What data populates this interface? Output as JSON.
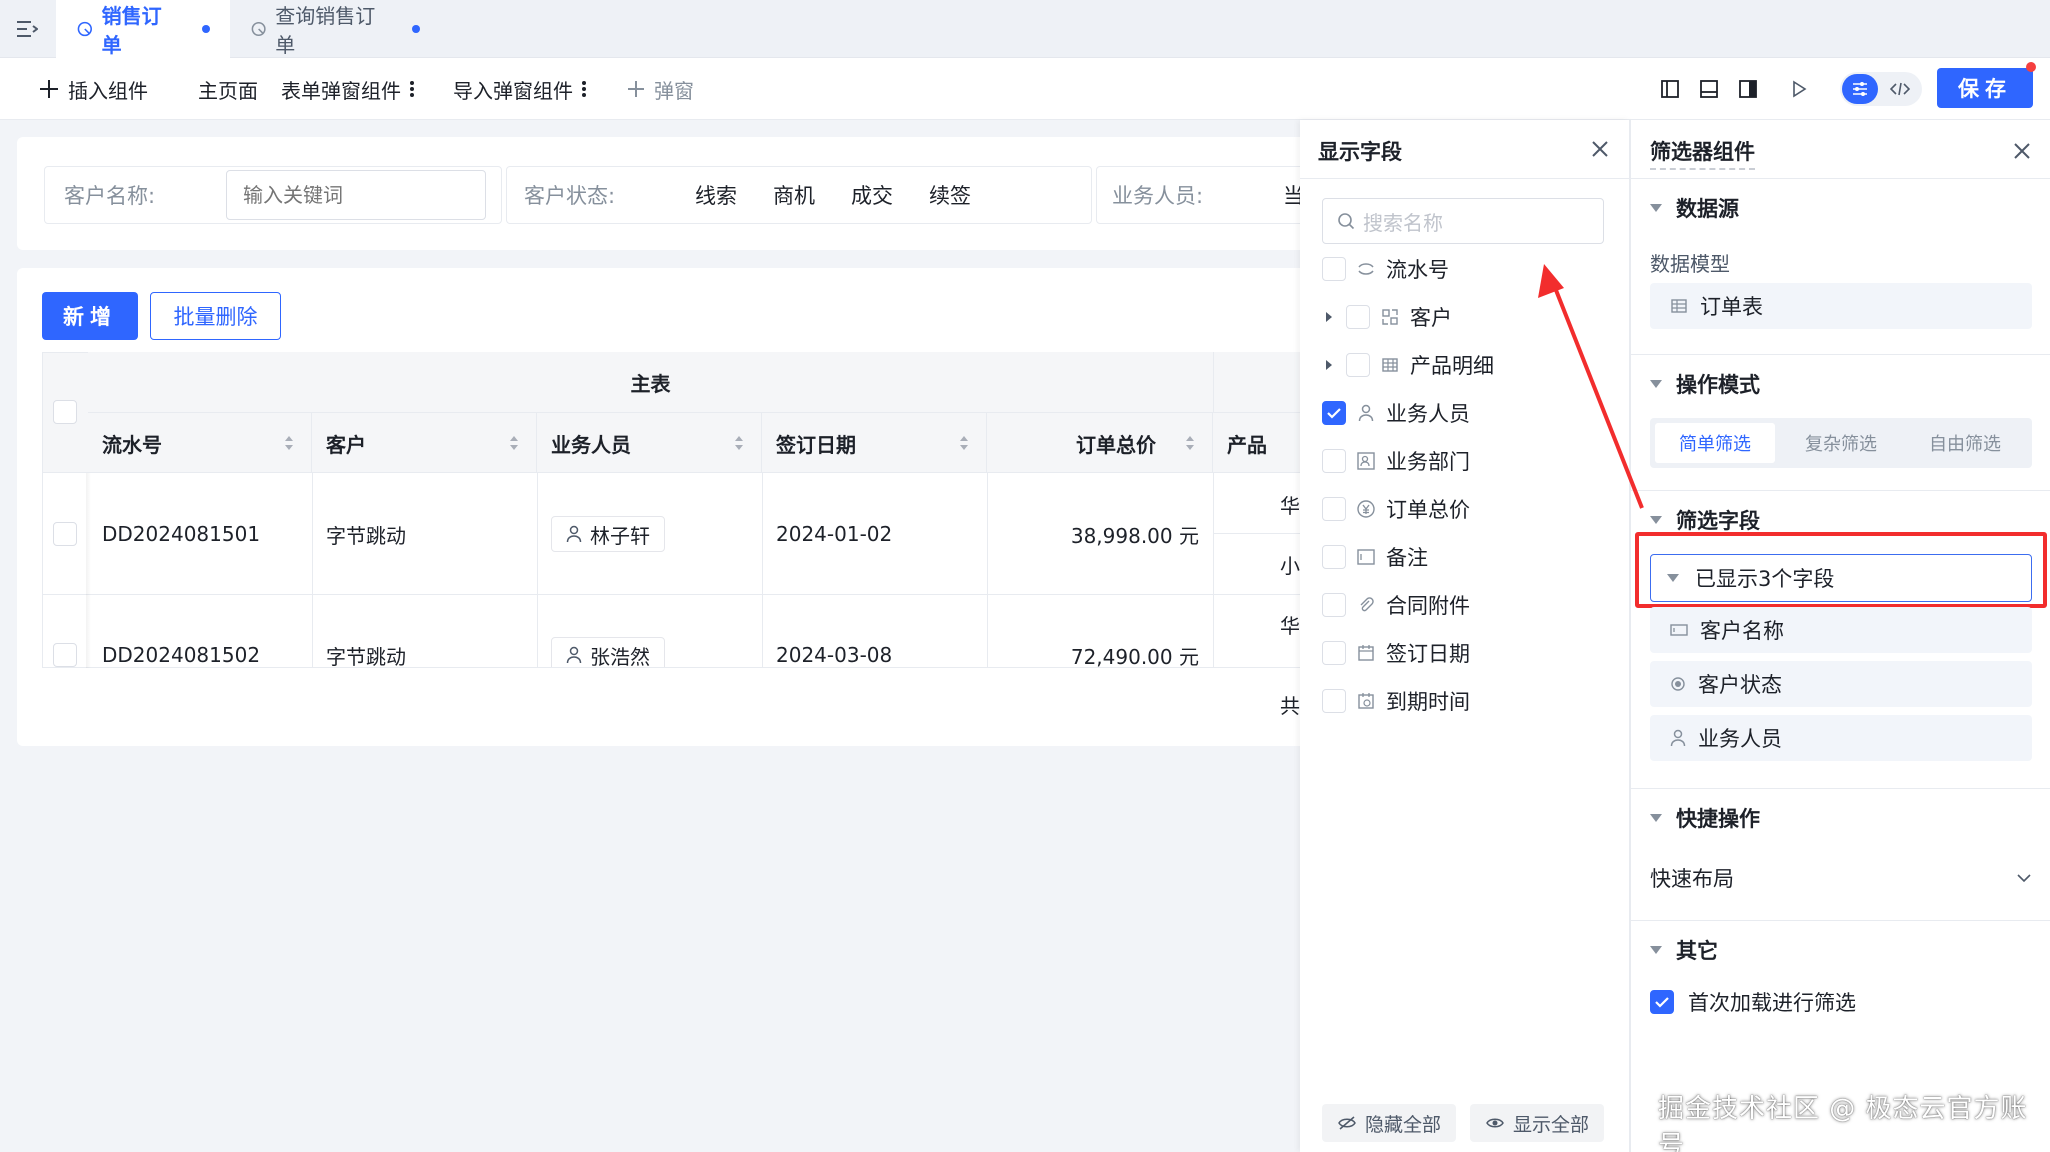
{
  "tabs": [
    {
      "label": "销售订单",
      "active": true
    },
    {
      "label": "查询销售订单",
      "active": false
    }
  ],
  "toolbar": {
    "insert": "插入组件",
    "main_page": "主页面",
    "form_popup": "表单弹窗组件",
    "import_popup": "导入弹窗组件",
    "popup": "弹窗",
    "save": "保存"
  },
  "filter": {
    "customer_name_label": "客户名称:",
    "customer_name_placeholder": "输入关键词",
    "customer_status_label": "客户状态:",
    "status_options": [
      "线索",
      "商机",
      "成交",
      "续签"
    ],
    "salesperson_label": "业务人员:",
    "salesperson_value_partial": "当"
  },
  "list": {
    "add_button": "新增",
    "batch_delete_button": "批量删除",
    "group_header": "主表",
    "columns": [
      "流水号",
      "客户",
      "业务人员",
      "签订日期",
      "订单总价",
      "产品"
    ],
    "rows": [
      {
        "serial": "DD2024081501",
        "customer": "字节跳动",
        "salesperson": "林子轩",
        "date": "2024-01-02",
        "total": "38,998.00 元",
        "product_partial": [
          "华",
          "小"
        ]
      },
      {
        "serial": "DD2024081502",
        "customer": "字节跳动",
        "salesperson": "张浩然",
        "date": "2024-03-08",
        "total": "72,490.00 元",
        "product_partial": [
          "华"
        ]
      }
    ],
    "footer_partial": "共"
  },
  "field_panel": {
    "title": "显示字段",
    "search_placeholder": "搜索名称",
    "fields": [
      {
        "label": "流水号",
        "checked": false,
        "expandable": false,
        "icon": "serial-icon"
      },
      {
        "label": "客户",
        "checked": false,
        "expandable": true,
        "icon": "relation-icon"
      },
      {
        "label": "产品明细",
        "checked": false,
        "expandable": true,
        "icon": "table-icon"
      },
      {
        "label": "业务人员",
        "checked": true,
        "expandable": false,
        "icon": "user-icon"
      },
      {
        "label": "业务部门",
        "checked": false,
        "expandable": false,
        "icon": "department-icon"
      },
      {
        "label": "订单总价",
        "checked": false,
        "expandable": false,
        "icon": "currency-icon"
      },
      {
        "label": "备注",
        "checked": false,
        "expandable": false,
        "icon": "textarea-icon"
      },
      {
        "label": "合同附件",
        "checked": false,
        "expandable": false,
        "icon": "attachment-icon"
      },
      {
        "label": "签订日期",
        "checked": false,
        "expandable": false,
        "icon": "calendar-icon"
      },
      {
        "label": "到期时间",
        "checked": false,
        "expandable": false,
        "icon": "clock-calendar-icon"
      }
    ],
    "hide_all": "隐藏全部",
    "show_all": "显示全部"
  },
  "config_panel": {
    "title": "筛选器组件",
    "datasource_header": "数据源",
    "data_model_label": "数据模型",
    "data_model_value": "订单表",
    "mode_header": "操作模式",
    "modes": [
      "简单筛选",
      "复杂筛选",
      "自由筛选"
    ],
    "active_mode": 0,
    "filter_fields_header": "筛选字段",
    "shown_fields_summary": "已显示3个字段",
    "shown_fields": [
      "客户名称",
      "客户状态",
      "业务人员"
    ],
    "quick_header": "快捷操作",
    "quick_layout": "快速布局",
    "other_header": "其它",
    "first_load_filter": "首次加载进行筛选"
  },
  "watermark": "掘金技术社区 @ 极态云官方账号",
  "colors": {
    "accent": "#2f66ff",
    "annotation_red": "#f22d2d"
  }
}
